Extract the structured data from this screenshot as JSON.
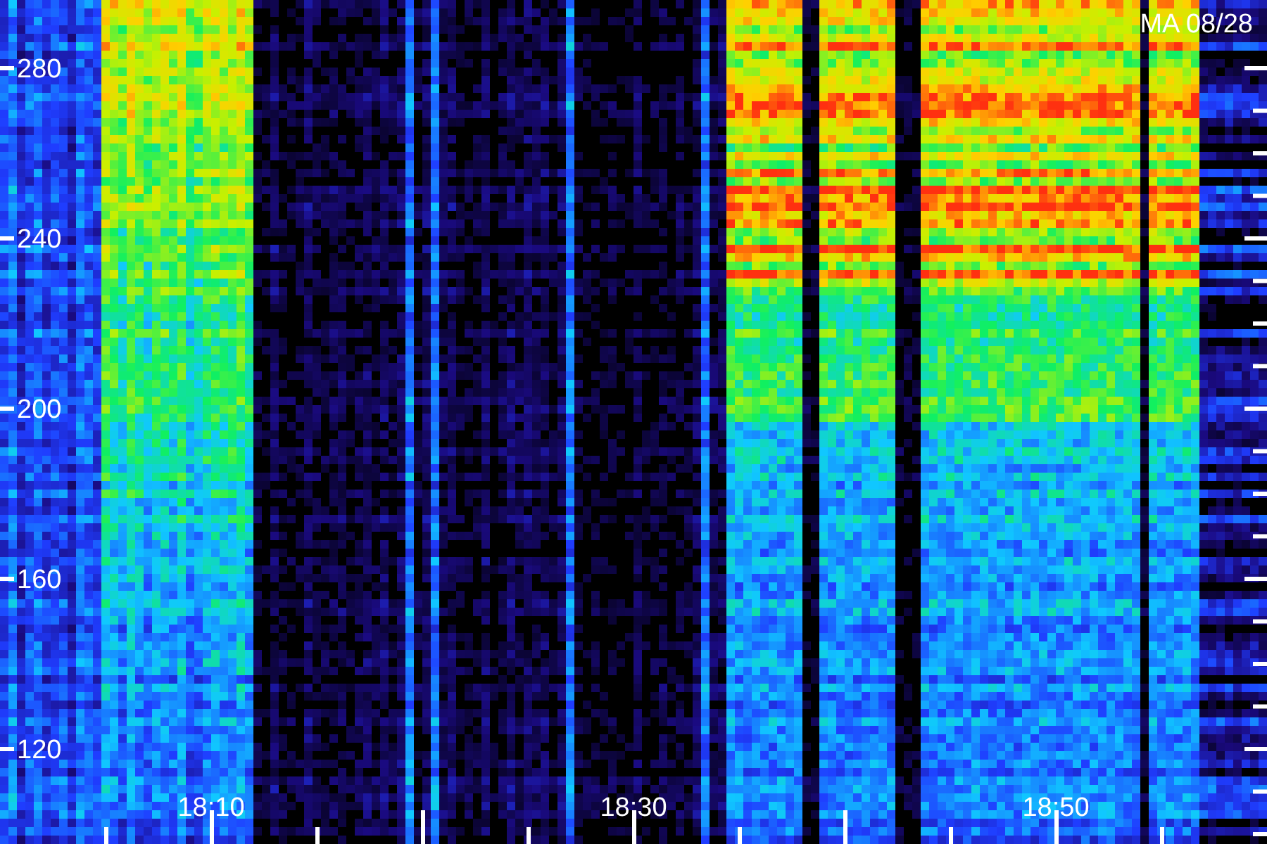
{
  "plot": {
    "date_label": "MA 08/28",
    "y_tick_labels": [
      "280",
      "240",
      "200",
      "160",
      "120"
    ],
    "x_tick_labels": [
      "18:10",
      "18:30",
      "18:50"
    ]
  }
}
